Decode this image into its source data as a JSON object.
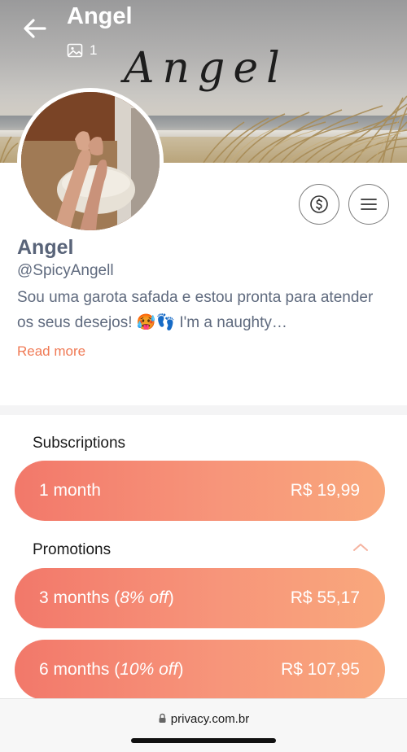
{
  "header": {
    "title": "Angel",
    "media_count": "1",
    "cover_script_text": "Angel"
  },
  "profile": {
    "display_name": "Angel",
    "username": "@SpicyAngell",
    "bio": "Sou uma garota safada e estou pronta para atender os seus desejos! 🥵👣 I'm a naughty…",
    "read_more": "Read more"
  },
  "subscriptions": {
    "label": "Subscriptions",
    "plans": [
      {
        "period": "1 month",
        "price": "R$ 19,99"
      }
    ]
  },
  "promotions": {
    "label": "Promotions",
    "plans": [
      {
        "period": "3 months (",
        "discount": "8% off",
        "close": ")",
        "price": "R$ 55,17"
      },
      {
        "period": "6 months (",
        "discount": "10% off",
        "close": ")",
        "price": "R$ 107,95"
      }
    ]
  },
  "browser": {
    "url": "privacy.com.br"
  },
  "icons": {
    "back": "arrow-left-icon",
    "media": "image-icon",
    "tip": "dollar-coin-icon",
    "menu": "hamburger-icon",
    "collapse": "chevron-up-icon",
    "lock": "lock-icon"
  },
  "colors": {
    "accent": "#f07a55",
    "plan_gradient_start": "#f2786a",
    "plan_gradient_end": "#f9a87c",
    "text_muted": "#5f6a7e"
  }
}
